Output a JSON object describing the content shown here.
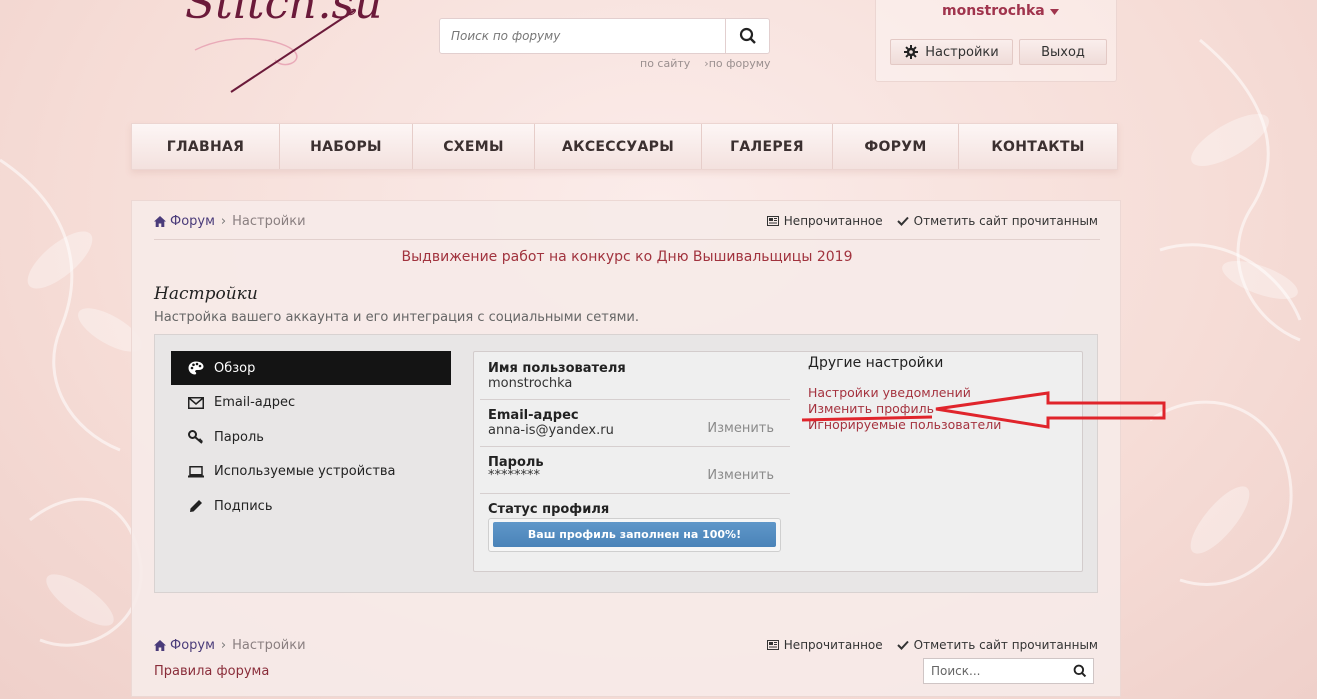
{
  "logo": {
    "text": "Stitch.su"
  },
  "search": {
    "placeholder": "Поиск по форуму",
    "scope_site": "по сайту",
    "scope_forum": "по форуму"
  },
  "user": {
    "name": "monstrochka",
    "settings_label": "Настройки",
    "logout_label": "Выход"
  },
  "nav": {
    "items": [
      "ГЛАВНАЯ",
      "НАБОРЫ",
      "СХЕМЫ",
      "АКСЕССУАРЫ",
      "ГАЛЕРЕЯ",
      "ФОРУМ",
      "КОНТАКТЫ"
    ]
  },
  "breadcrumb": {
    "forum": "Форум",
    "settings": "Настройки"
  },
  "links": {
    "unread": "Непрочитанное",
    "mark_read": "Отметить сайт прочитанным"
  },
  "notice": "Выдвижение работ на конкурс ко Дню Вышивальщицы 2019",
  "page": {
    "title": "Настройки",
    "subtitle": "Настройка вашего аккаунта и его интеграция с социальными сетями."
  },
  "sidebar": {
    "items": [
      {
        "label": "Обзор",
        "icon": "palette-icon"
      },
      {
        "label": "Email-адрес",
        "icon": "envelope-icon"
      },
      {
        "label": "Пароль",
        "icon": "key-icon"
      },
      {
        "label": "Используемые устройства",
        "icon": "laptop-icon"
      },
      {
        "label": "Подпись",
        "icon": "pencil-icon"
      }
    ]
  },
  "account": {
    "username_label": "Имя пользователя",
    "username_value": "monstrochka",
    "email_label": "Email-адрес",
    "email_value": "anna-is@yandex.ru",
    "password_label": "Пароль",
    "password_value": "********",
    "change_label": "Изменить",
    "status_label": "Статус профиля",
    "status_text": "Ваш профиль заполнен на 100%!",
    "status_percent": 100
  },
  "other": {
    "heading": "Другие настройки",
    "links": [
      "Настройки уведомлений",
      "Изменить профиль",
      "Игнорируемые пользователи"
    ]
  },
  "footer": {
    "rules": "Правила форума",
    "search_placeholder": "Поиск..."
  },
  "colors": {
    "accent": "#a5333f",
    "annotation": "#e0242b",
    "progress": "#4f89bd"
  }
}
